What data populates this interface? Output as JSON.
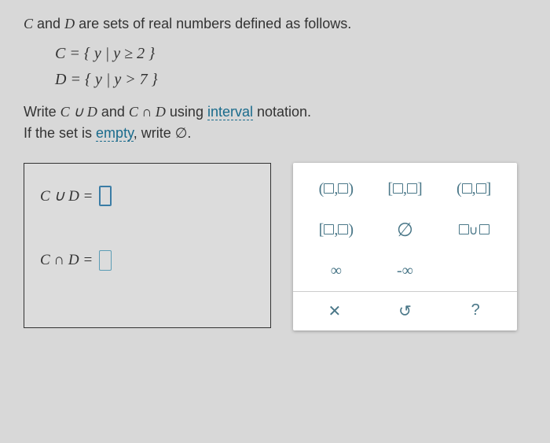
{
  "question": {
    "intro_pre": "",
    "var1": "C",
    "join1": " and ",
    "var2": "D",
    "intro_post": " are sets of real numbers defined as follows."
  },
  "sets": {
    "c_def": "C = { y | y ≥ 2 }",
    "d_def": "D = { y | y > 7 }"
  },
  "instruct": {
    "t1": "Write ",
    "expr1": "C ∪ D",
    "t2": " and ",
    "expr2": "C ∩ D",
    "t3": " using ",
    "link1": "interval",
    "t4": " notation.",
    "t5": "If the set is ",
    "link2": "empty",
    "t6": ", write ∅."
  },
  "answers": {
    "union_label": "C ∪ D =",
    "intersect_label": "C ∩ D ="
  },
  "palette": {
    "open_open": "(□,□)",
    "closed_closed": "[□,□]",
    "open_closed": "(□,□]",
    "closed_open": "[□,□)",
    "empty_set": "∅",
    "union_piece": "□∪□",
    "infinity": "∞",
    "neg_infinity": "-∞"
  },
  "footer": {
    "clear": "✕",
    "reset": "↺",
    "help": "?"
  }
}
